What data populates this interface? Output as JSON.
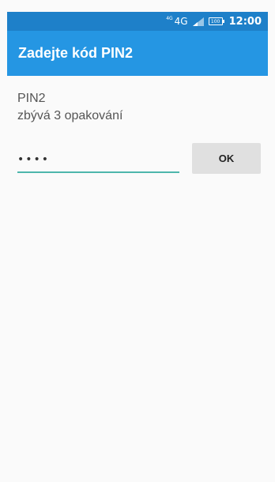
{
  "status_bar": {
    "network_sup": "4G",
    "network": "4G",
    "battery": "100",
    "time": "12:00"
  },
  "app_bar": {
    "title": "Zadejte kód PIN2"
  },
  "dialog": {
    "line1": "PIN2",
    "line2": "zbývá 3 opakování",
    "pin_value": "••••",
    "ok_label": "OK"
  },
  "colors": {
    "status_bar": "#1e80c9",
    "app_bar": "#2596e3",
    "input_underline": "#4db6ac",
    "button_bg": "#e0e0e0"
  },
  "icons": {
    "signal": "signal-icon",
    "battery": "battery-icon"
  }
}
